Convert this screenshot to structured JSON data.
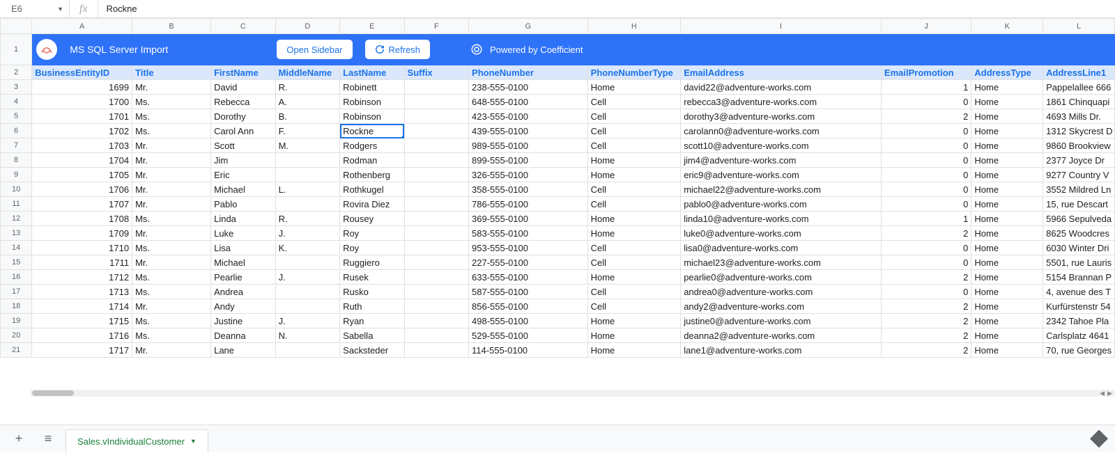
{
  "nameBox": "E6",
  "formulaValue": "Rockne",
  "columns": [
    "A",
    "B",
    "C",
    "D",
    "E",
    "F",
    "G",
    "H",
    "I",
    "J",
    "K",
    "L"
  ],
  "banner": {
    "title": "MS SQL Server Import",
    "openSidebar": "Open Sidebar",
    "refresh": "Refresh",
    "poweredBy": "Powered by Coefficient"
  },
  "headers": {
    "A": "BusinessEntityID",
    "B": "Title",
    "C": "FirstName",
    "D": "MiddleName",
    "E": "LastName",
    "F": "Suffix",
    "G": "PhoneNumber",
    "H": "PhoneNumberType",
    "I": "EmailAddress",
    "J": "EmailPromotion",
    "K": "AddressType",
    "L": "AddressLine1"
  },
  "selectedCell": {
    "row": 6,
    "col": "E"
  },
  "rows": [
    {
      "n": 3,
      "A": "1699",
      "B": "Mr.",
      "C": "David",
      "D": "R.",
      "E": "Robinett",
      "F": "",
      "G": "238-555-0100",
      "H": "Home",
      "I": "david22@adventure-works.com",
      "J": "1",
      "K": "Home",
      "L": "Pappelallee 666"
    },
    {
      "n": 4,
      "A": "1700",
      "B": "Ms.",
      "C": "Rebecca",
      "D": "A.",
      "E": "Robinson",
      "F": "",
      "G": "648-555-0100",
      "H": "Cell",
      "I": "rebecca3@adventure-works.com",
      "J": "0",
      "K": "Home",
      "L": "1861 Chinquapi"
    },
    {
      "n": 5,
      "A": "1701",
      "B": "Ms.",
      "C": "Dorothy",
      "D": "B.",
      "E": "Robinson",
      "F": "",
      "G": "423-555-0100",
      "H": "Cell",
      "I": "dorothy3@adventure-works.com",
      "J": "2",
      "K": "Home",
      "L": "4693 Mills Dr."
    },
    {
      "n": 6,
      "A": "1702",
      "B": "Ms.",
      "C": "Carol Ann",
      "D": "F.",
      "E": "Rockne",
      "F": "",
      "G": "439-555-0100",
      "H": "Cell",
      "I": "carolann0@adventure-works.com",
      "J": "0",
      "K": "Home",
      "L": "1312 Skycrest D"
    },
    {
      "n": 7,
      "A": "1703",
      "B": "Mr.",
      "C": "Scott",
      "D": "M.",
      "E": "Rodgers",
      "F": "",
      "G": "989-555-0100",
      "H": "Cell",
      "I": "scott10@adventure-works.com",
      "J": "0",
      "K": "Home",
      "L": "9860 Brookview"
    },
    {
      "n": 8,
      "A": "1704",
      "B": "Mr.",
      "C": "Jim",
      "D": "",
      "E": "Rodman",
      "F": "",
      "G": "899-555-0100",
      "H": "Home",
      "I": "jim4@adventure-works.com",
      "J": "0",
      "K": "Home",
      "L": "2377 Joyce Dr"
    },
    {
      "n": 9,
      "A": "1705",
      "B": "Mr.",
      "C": "Eric",
      "D": "",
      "E": "Rothenberg",
      "F": "",
      "G": "326-555-0100",
      "H": "Home",
      "I": "eric9@adventure-works.com",
      "J": "0",
      "K": "Home",
      "L": "9277 Country V"
    },
    {
      "n": 10,
      "A": "1706",
      "B": "Mr.",
      "C": "Michael",
      "D": "L.",
      "E": "Rothkugel",
      "F": "",
      "G": "358-555-0100",
      "H": "Cell",
      "I": "michael22@adventure-works.com",
      "J": "0",
      "K": "Home",
      "L": "3552 Mildred Ln"
    },
    {
      "n": 11,
      "A": "1707",
      "B": "Mr.",
      "C": "Pablo",
      "D": "",
      "E": "Rovira Diez",
      "F": "",
      "G": "786-555-0100",
      "H": "Cell",
      "I": "pablo0@adventure-works.com",
      "J": "0",
      "K": "Home",
      "L": "15, rue Descart"
    },
    {
      "n": 12,
      "A": "1708",
      "B": "Ms.",
      "C": "Linda",
      "D": "R.",
      "E": "Rousey",
      "F": "",
      "G": "369-555-0100",
      "H": "Home",
      "I": "linda10@adventure-works.com",
      "J": "1",
      "K": "Home",
      "L": "5966 Sepulveda"
    },
    {
      "n": 13,
      "A": "1709",
      "B": "Mr.",
      "C": "Luke",
      "D": "J.",
      "E": "Roy",
      "F": "",
      "G": "583-555-0100",
      "H": "Home",
      "I": "luke0@adventure-works.com",
      "J": "2",
      "K": "Home",
      "L": "8625 Woodcres"
    },
    {
      "n": 14,
      "A": "1710",
      "B": "Ms.",
      "C": "Lisa",
      "D": "K.",
      "E": "Roy",
      "F": "",
      "G": "953-555-0100",
      "H": "Cell",
      "I": "lisa0@adventure-works.com",
      "J": "0",
      "K": "Home",
      "L": "6030 Winter Dri"
    },
    {
      "n": 15,
      "A": "1711",
      "B": "Mr.",
      "C": "Michael",
      "D": "",
      "E": "Ruggiero",
      "F": "",
      "G": "227-555-0100",
      "H": "Cell",
      "I": "michael23@adventure-works.com",
      "J": "0",
      "K": "Home",
      "L": "5501, rue Lauris"
    },
    {
      "n": 16,
      "A": "1712",
      "B": "Ms.",
      "C": "Pearlie",
      "D": "J.",
      "E": "Rusek",
      "F": "",
      "G": "633-555-0100",
      "H": "Home",
      "I": "pearlie0@adventure-works.com",
      "J": "2",
      "K": "Home",
      "L": "5154 Brannan P"
    },
    {
      "n": 17,
      "A": "1713",
      "B": "Ms.",
      "C": "Andrea",
      "D": "",
      "E": "Rusko",
      "F": "",
      "G": "587-555-0100",
      "H": "Cell",
      "I": "andrea0@adventure-works.com",
      "J": "0",
      "K": "Home",
      "L": "4, avenue des T"
    },
    {
      "n": 18,
      "A": "1714",
      "B": "Mr.",
      "C": "Andy",
      "D": "",
      "E": "Ruth",
      "F": "",
      "G": "856-555-0100",
      "H": "Cell",
      "I": "andy2@adventure-works.com",
      "J": "2",
      "K": "Home",
      "L": "Kurfürstenstr 54"
    },
    {
      "n": 19,
      "A": "1715",
      "B": "Ms.",
      "C": "Justine",
      "D": "J.",
      "E": "Ryan",
      "F": "",
      "G": "498-555-0100",
      "H": "Home",
      "I": "justine0@adventure-works.com",
      "J": "2",
      "K": "Home",
      "L": "2342 Tahoe Pla"
    },
    {
      "n": 20,
      "A": "1716",
      "B": "Ms.",
      "C": "Deanna",
      "D": "N.",
      "E": "Sabella",
      "F": "",
      "G": "529-555-0100",
      "H": "Home",
      "I": "deanna2@adventure-works.com",
      "J": "2",
      "K": "Home",
      "L": "Carlsplatz 4641"
    },
    {
      "n": 21,
      "A": "1717",
      "B": "Mr.",
      "C": "Lane",
      "D": "",
      "E": "Sacksteder",
      "F": "",
      "G": "114-555-0100",
      "H": "Home",
      "I": "lane1@adventure-works.com",
      "J": "2",
      "K": "Home",
      "L": "70, rue Georges"
    }
  ],
  "sheetTab": "Sales.vIndividualCustomer",
  "numericCols": [
    "A",
    "J"
  ]
}
